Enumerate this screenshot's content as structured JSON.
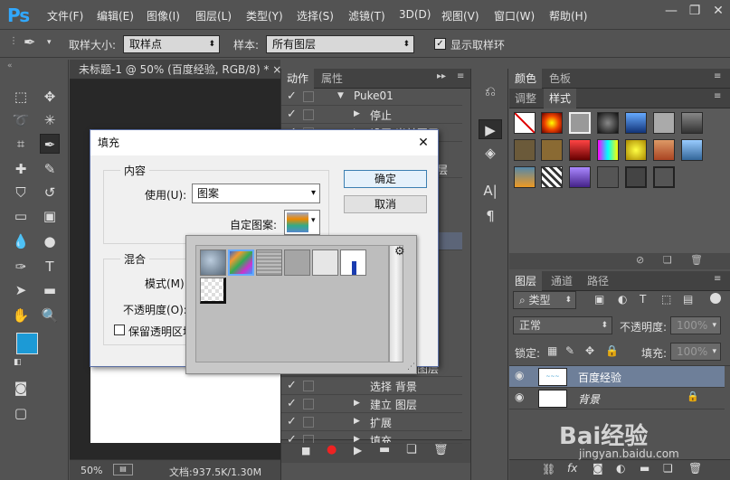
{
  "app": {
    "logo": "Ps"
  },
  "menu": [
    "文件(F)",
    "编辑(E)",
    "图像(I)",
    "图层(L)",
    "类型(Y)",
    "选择(S)",
    "滤镜(T)",
    "3D(D)",
    "视图(V)",
    "窗口(W)",
    "帮助(H)"
  ],
  "window_controls": {
    "minimize": "—",
    "restore": "❐",
    "close": "✕"
  },
  "options": {
    "sample_size_label": "取样大小:",
    "sample_size_value": "取样点",
    "sample_label": "样本:",
    "sample_value": "所有图层",
    "show_ring_label": "显示取样环"
  },
  "document": {
    "tab_title": "未标题-1 @ 50% (百度经验, RGB/8) *",
    "close": "×"
  },
  "status": {
    "zoom": "50%",
    "doc_info": "文档:937.5K/1.30M"
  },
  "actions_panel": {
    "tabs": [
      "动作",
      "属性"
    ],
    "rows": [
      {
        "text": "Puke01",
        "partial": false
      },
      {
        "text": "停止",
        "partial": false
      },
      {
        "text": "设置 当前图层",
        "partial": true
      },
      {
        "text": "图层",
        "partial": true
      },
      {
        "text": "选择 背景",
        "partial": false
      },
      {
        "text": "建立 图层",
        "partial": false
      },
      {
        "text": "扩展",
        "partial": false
      },
      {
        "text": "填充",
        "partial": true
      }
    ]
  },
  "swatches_panel": {
    "tabs": [
      "颜色",
      "色板"
    ],
    "tabs2": [
      "调整",
      "样式"
    ]
  },
  "layers_panel": {
    "tabs": [
      "图层",
      "通道",
      "路径"
    ],
    "filter_label": "类型",
    "blend_mode": "正常",
    "opacity_label": "不透明度:",
    "opacity_value": "100%",
    "lock_label": "锁定:",
    "fill_label": "填充:",
    "fill_value": "100%",
    "layers": [
      {
        "name": "百度经验",
        "selected": true
      },
      {
        "name": "背景",
        "selected": false
      }
    ]
  },
  "fill_dialog": {
    "title": "填充",
    "close": "✕",
    "content_group": "内容",
    "use_label": "使用(U):",
    "use_value": "图案",
    "custom_pattern_label": "自定图案:",
    "blend_group": "混合",
    "mode_label": "模式(M):",
    "opacity_label": "不透明度(O):",
    "preserve_label": "保留透明区域",
    "ok": "确定",
    "cancel": "取消"
  },
  "pattern_picker": {
    "menu_icon": "⚙"
  },
  "watermark": {
    "line1": "Bai经验",
    "line2": "jingyan.baidu.com"
  },
  "colors": {
    "accent": "#31a8ff",
    "foreground": "#1c9ad6",
    "background": "#ffffff",
    "selected_layer": "#6e7f99"
  }
}
